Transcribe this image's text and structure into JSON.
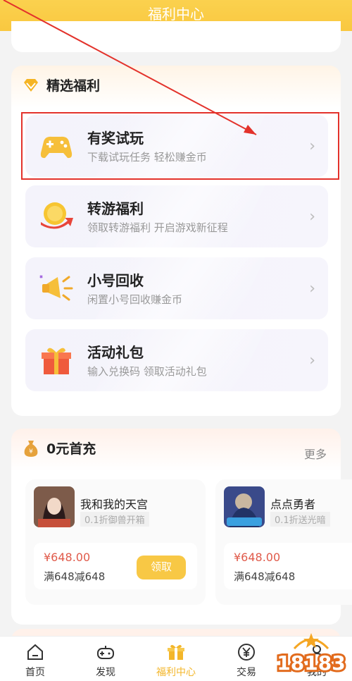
{
  "header": {
    "title": "福利中心"
  },
  "featured": {
    "title": "精选福利",
    "items": [
      {
        "title": "有奖试玩",
        "subtitle": "下载试玩任务 轻松赚金币",
        "icon": "gamepad-icon"
      },
      {
        "title": "转游福利",
        "subtitle": "领取转游福利 开启游戏新征程",
        "icon": "coin-transfer-icon"
      },
      {
        "title": "小号回收",
        "subtitle": "闲置小号回收赚金币",
        "icon": "megaphone-icon"
      },
      {
        "title": "活动礼包",
        "subtitle": "输入兑换码 领取活动礼包",
        "icon": "gift-box-icon"
      }
    ]
  },
  "first_charge": {
    "title": "0元首充",
    "more": "更多",
    "games": [
      {
        "name": "我和我的天宫",
        "tag": "0.1折御兽开箱",
        "price": "¥648.00",
        "deal": "满648减648",
        "claim": "领取"
      },
      {
        "name": "点点勇者",
        "tag": "0.1折送光暗",
        "price": "¥648.00",
        "deal": "满648减648"
      }
    ]
  },
  "tabs": [
    {
      "label": "首页",
      "icon": "home-icon"
    },
    {
      "label": "发现",
      "icon": "gamepad-outline-icon"
    },
    {
      "label": "福利中心",
      "icon": "gift-icon",
      "active": true
    },
    {
      "label": "交易",
      "icon": "yen-icon"
    },
    {
      "label": "我的",
      "icon": "user-icon"
    }
  ],
  "watermark": "18183",
  "colors": {
    "accent": "#f8c845",
    "highlight": "#e3322b",
    "price": "#e05a4a"
  }
}
